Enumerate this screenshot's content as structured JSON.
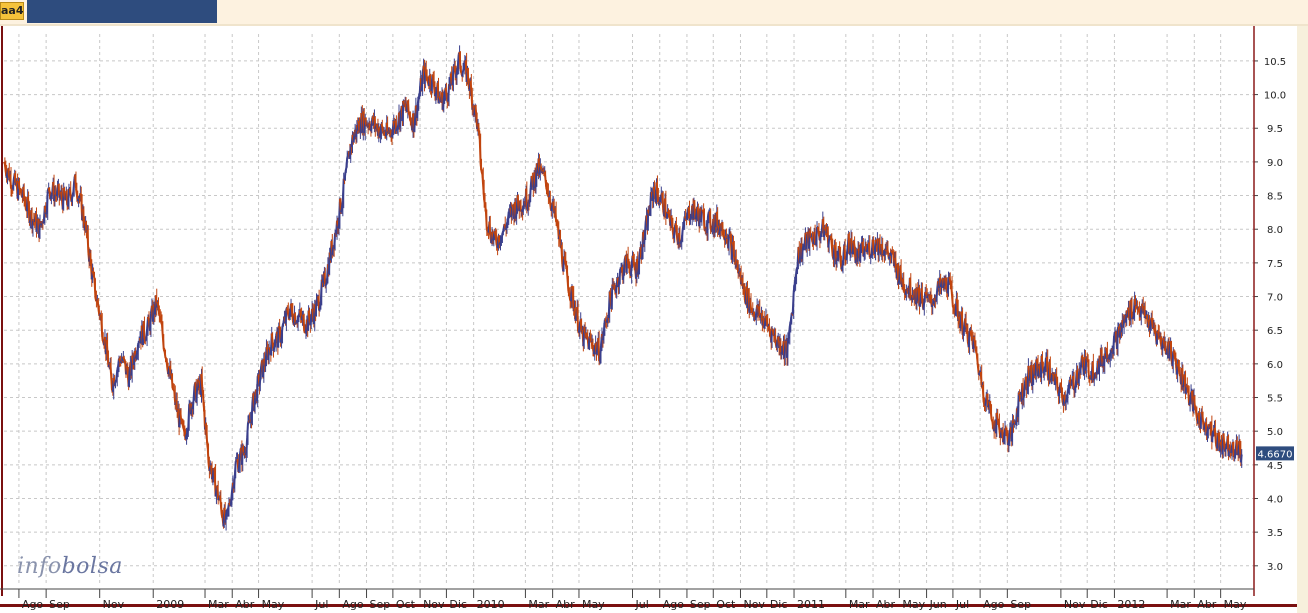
{
  "window": {
    "tab_label": "aa4"
  },
  "watermark": {
    "part1": "info",
    "part2": "bolsa"
  },
  "colors": {
    "up_candle": "#3a3f8c",
    "down_candle": "#c1440e",
    "grid": "#c8c8c8",
    "last_price_badge": "#2e4c7e",
    "axis_line": "#8b1a1a"
  },
  "chart_data": {
    "type": "line",
    "title": "",
    "xlabel": "",
    "ylabel": "",
    "ylim": [
      2.7,
      10.9
    ],
    "yticks": [
      3.0,
      3.5,
      4.0,
      4.5,
      5.0,
      5.5,
      6.0,
      6.5,
      7.0,
      7.5,
      8.0,
      8.5,
      9.0,
      9.5,
      10.0,
      10.5
    ],
    "ytick_labels": [
      "3.0",
      "3.5",
      "4.0",
      "4.5",
      "5.0",
      "5.5",
      "6.0",
      "6.5",
      "7.0",
      "7.5",
      "8.0",
      "8.5",
      "9.0",
      "9.5",
      "10.0",
      "10.5"
    ],
    "x_range": [
      "2008-07-15",
      "2012-06-08"
    ],
    "xtick_labels": [
      "Ago",
      "Sep",
      "Nov",
      "2009",
      "Mar",
      "Abr",
      "May",
      "Jul",
      "Ago",
      "Sep",
      "Oct",
      "Nov",
      "Dic",
      "2010",
      "Mar",
      "Abr",
      "May",
      "Jul",
      "Ago",
      "Sep",
      "Oct",
      "Nov",
      "Dic",
      "2011",
      "Mar",
      "Abr",
      "May",
      "Jun",
      "Jul",
      "Ago",
      "Sep",
      "Nov",
      "Dic",
      "2012",
      "Mar",
      "Abr",
      "May"
    ],
    "xtick_dates": [
      "2008-08-01",
      "2008-09-01",
      "2008-11-01",
      "2009-01-01",
      "2009-03-01",
      "2009-04-01",
      "2009-05-01",
      "2009-07-01",
      "2009-08-01",
      "2009-09-01",
      "2009-10-01",
      "2009-11-01",
      "2009-12-01",
      "2010-01-01",
      "2010-03-01",
      "2010-04-01",
      "2010-05-01",
      "2010-07-01",
      "2010-08-01",
      "2010-09-01",
      "2010-10-01",
      "2010-11-01",
      "2010-12-01",
      "2011-01-01",
      "2011-03-01",
      "2011-04-01",
      "2011-05-01",
      "2011-06-01",
      "2011-07-01",
      "2011-08-01",
      "2011-09-01",
      "2011-11-01",
      "2011-12-01",
      "2012-01-01",
      "2012-03-01",
      "2012-04-01",
      "2012-05-01"
    ],
    "series": [
      {
        "dates": [
          "2008-07-15",
          "2008-07-25",
          "2008-08-05",
          "2008-08-15",
          "2008-08-25",
          "2008-09-05",
          "2008-09-15",
          "2008-09-25",
          "2008-10-05",
          "2008-10-15",
          "2008-10-25",
          "2008-11-05",
          "2008-11-15",
          "2008-11-25",
          "2008-12-05",
          "2008-12-15",
          "2008-12-25",
          "2009-01-05",
          "2009-01-15",
          "2009-01-25",
          "2009-02-05",
          "2009-02-15",
          "2009-02-25",
          "2009-03-05",
          "2009-03-15",
          "2009-03-25",
          "2009-04-05",
          "2009-04-15",
          "2009-04-25",
          "2009-05-05",
          "2009-05-15",
          "2009-05-25",
          "2009-06-05",
          "2009-06-15",
          "2009-06-25",
          "2009-07-05",
          "2009-07-15",
          "2009-07-25",
          "2009-08-05",
          "2009-08-15",
          "2009-08-25",
          "2009-09-05",
          "2009-09-15",
          "2009-09-25",
          "2009-10-05",
          "2009-10-15",
          "2009-10-25",
          "2009-11-05",
          "2009-11-15",
          "2009-11-25",
          "2009-12-05",
          "2009-12-15",
          "2009-12-25",
          "2010-01-05",
          "2010-01-15",
          "2010-01-25",
          "2010-02-05",
          "2010-02-15",
          "2010-02-25",
          "2010-03-05",
          "2010-03-15",
          "2010-03-25",
          "2010-04-05",
          "2010-04-15",
          "2010-04-25",
          "2010-05-05",
          "2010-05-15",
          "2010-05-25",
          "2010-06-05",
          "2010-06-15",
          "2010-06-25",
          "2010-07-05",
          "2010-07-15",
          "2010-07-25",
          "2010-08-05",
          "2010-08-15",
          "2010-08-25",
          "2010-09-05",
          "2010-09-15",
          "2010-09-25",
          "2010-10-05",
          "2010-10-15",
          "2010-10-25",
          "2010-11-05",
          "2010-11-15",
          "2010-11-25",
          "2010-12-05",
          "2010-12-15",
          "2010-12-25",
          "2011-01-05",
          "2011-01-15",
          "2011-01-25",
          "2011-02-05",
          "2011-02-15",
          "2011-02-25",
          "2011-03-05",
          "2011-03-15",
          "2011-03-25",
          "2011-04-05",
          "2011-04-15",
          "2011-04-25",
          "2011-05-05",
          "2011-05-15",
          "2011-05-25",
          "2011-06-05",
          "2011-06-15",
          "2011-06-25",
          "2011-07-05",
          "2011-07-15",
          "2011-07-25",
          "2011-08-05",
          "2011-08-15",
          "2011-08-25",
          "2011-09-05",
          "2011-09-15",
          "2011-09-25",
          "2011-10-05",
          "2011-10-15",
          "2011-10-25",
          "2011-11-05",
          "2011-11-15",
          "2011-11-25",
          "2011-12-05",
          "2011-12-15",
          "2011-12-25",
          "2012-01-05",
          "2012-01-15",
          "2012-01-25",
          "2012-02-05",
          "2012-02-15",
          "2012-02-25",
          "2012-03-05",
          "2012-03-15",
          "2012-03-25",
          "2012-04-05",
          "2012-04-15",
          "2012-04-25",
          "2012-05-05",
          "2012-05-15",
          "2012-05-25",
          "2012-06-05"
        ],
        "values": [
          9.0,
          8.7,
          8.5,
          8.2,
          8.0,
          8.6,
          8.5,
          8.4,
          8.7,
          8.1,
          7.2,
          6.5,
          5.7,
          6.1,
          5.8,
          6.4,
          6.5,
          6.9,
          6.2,
          5.5,
          4.9,
          5.5,
          5.7,
          4.6,
          4.1,
          3.6,
          4.5,
          4.7,
          5.4,
          5.9,
          6.3,
          6.4,
          6.8,
          6.7,
          6.6,
          6.8,
          7.2,
          7.8,
          8.5,
          9.3,
          9.6,
          9.6,
          9.5,
          9.4,
          9.6,
          9.8,
          9.6,
          10.3,
          10.2,
          9.9,
          10.1,
          10.5,
          10.3,
          9.6,
          8.2,
          7.8,
          8.0,
          8.3,
          8.4,
          8.5,
          8.9,
          8.7,
          8.1,
          7.4,
          6.9,
          6.4,
          6.3,
          6.2,
          6.9,
          7.3,
          7.5,
          7.4,
          7.9,
          8.6,
          8.4,
          8.0,
          7.9,
          8.3,
          8.2,
          8.1,
          8.1,
          8.0,
          7.6,
          7.1,
          6.8,
          6.7,
          6.5,
          6.3,
          6.2,
          7.6,
          7.8,
          7.9,
          8.0,
          7.7,
          7.5,
          7.8,
          7.6,
          7.7,
          7.8,
          7.7,
          7.5,
          7.2,
          7.1,
          7.0,
          6.9,
          7.1,
          7.2,
          6.8,
          6.5,
          6.3,
          5.6,
          5.2,
          5.0,
          4.9,
          5.5,
          5.8,
          5.9,
          6.0,
          5.7,
          5.5,
          5.7,
          6.0,
          5.9,
          6.0,
          6.2,
          6.4,
          6.7,
          6.9,
          6.7,
          6.5,
          6.3,
          6.2,
          5.9,
          5.6,
          5.2,
          5.1,
          4.9,
          4.8,
          4.8,
          4.67
        ]
      }
    ],
    "last_price_label": "4.6670",
    "grid": true,
    "legend": "none"
  }
}
